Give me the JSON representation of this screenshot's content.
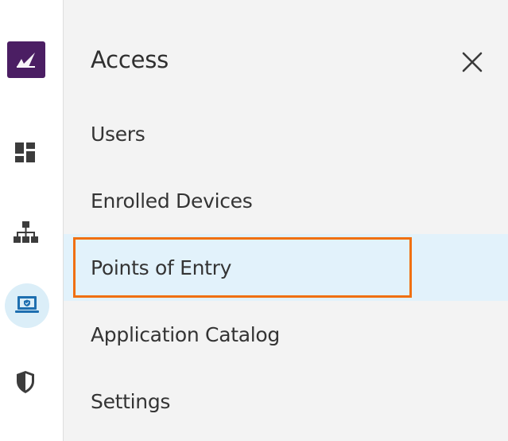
{
  "panel": {
    "title": "Access",
    "close_icon": "close-icon"
  },
  "rail": {
    "items": [
      {
        "name": "logo",
        "icon": "brand-logo-icon"
      },
      {
        "name": "dashboard",
        "icon": "dashboard-icon"
      },
      {
        "name": "network",
        "icon": "network-topology-icon"
      },
      {
        "name": "access",
        "icon": "secure-laptop-icon",
        "active": true
      },
      {
        "name": "security",
        "icon": "shield-icon"
      }
    ]
  },
  "menu": {
    "items": [
      {
        "label": "Users"
      },
      {
        "label": "Enrolled Devices"
      },
      {
        "label": "Points of Entry",
        "selected": true
      },
      {
        "label": "Application Catalog"
      },
      {
        "label": "Settings"
      }
    ]
  },
  "colors": {
    "brand": "#4b1e63",
    "selected_bg": "#e2f2fb",
    "highlight_border": "#f07012",
    "active_icon": "#1e6fb0"
  }
}
